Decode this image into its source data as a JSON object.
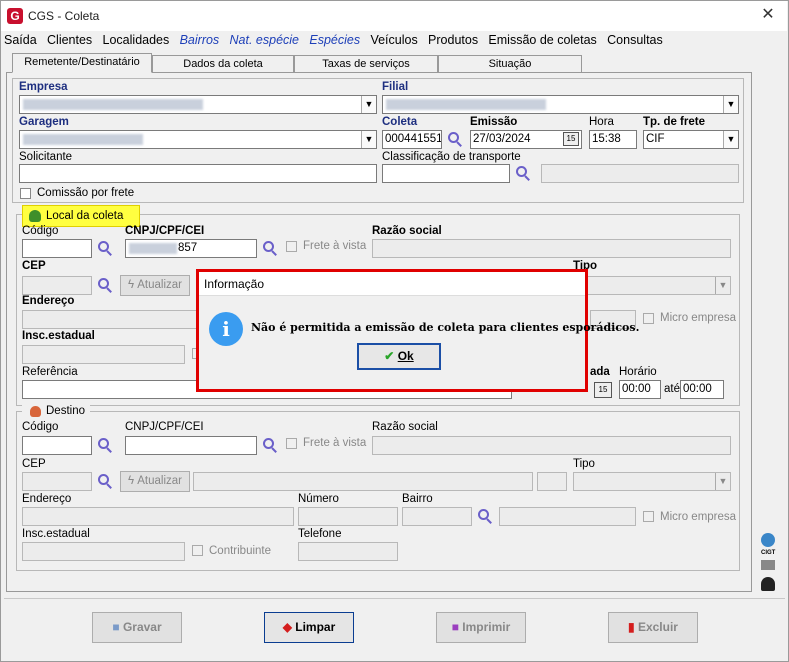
{
  "window": {
    "title": "CGS - Coleta"
  },
  "menu": [
    "Saída",
    "Clientes",
    "Localidades",
    "Bairros",
    "Nat. espécie",
    "Espécies",
    "Veículos",
    "Produtos",
    "Emissão de coletas",
    "Consultas"
  ],
  "tabs": [
    "Remetente/Destinatário",
    "Dados da coleta",
    "Taxas de serviços",
    "Situação"
  ],
  "header": {
    "empresa_label": "Empresa",
    "filial_label": "Filial",
    "garagem_label": "Garagem",
    "coleta_label": "Coleta",
    "coleta_value": "000441551",
    "emissao_label": "Emissão",
    "emissao_value": "27/03/2024",
    "hora_label": "Hora",
    "hora_value": "15:38",
    "tpfrete_label": "Tp. de frete",
    "tpfrete_value": "CIF",
    "solicitante_label": "Solicitante",
    "classif_label": "Classificação de transporte",
    "comissao_label": "Comissão por frete"
  },
  "origem": {
    "group_label": "Local da coleta",
    "codigo_label": "Código",
    "cnpj_label": "CNPJ/CPF/CEI",
    "cnpj_value": "857",
    "frete_vista_label": "Frete à vista",
    "razao_label": "Razão social",
    "cep_label": "CEP",
    "atualizar_label": "Atualizar",
    "tipo_label": "Tipo",
    "endereco_label": "Endereço",
    "micro_label": "Micro empresa",
    "insc_label": "Insc.estadual",
    "referencia_label": "Referência",
    "chegada_label": "ada",
    "horario_label": "Horário",
    "horario_de": "00:00",
    "ate_label": "até",
    "horario_ate": "00:00"
  },
  "destino": {
    "group_label": "Destino",
    "codigo_label": "Código",
    "cnpj_label": "CNPJ/CPF/CEI",
    "frete_vista_label": "Frete à vista",
    "razao_label": "Razão social",
    "cep_label": "CEP",
    "atualizar_label": "Atualizar",
    "tipo_label": "Tipo",
    "endereco_label": "Endereço",
    "numero_label": "Número",
    "bairro_label": "Bairro",
    "micro_label": "Micro empresa",
    "insc_label": "Insc.estadual",
    "contribuinte_label": "Contribuinte",
    "telefone_label": "Telefone"
  },
  "buttons": {
    "gravar": "Gravar",
    "limpar": "Limpar",
    "imprimir": "Imprimir",
    "excluir": "Excluir"
  },
  "dialog": {
    "title": "Informação",
    "message": "Não é permitida a emissão de coleta para clientes esporádicos.",
    "ok": "Ok"
  },
  "side": {
    "cigt_label": "CIGT"
  }
}
